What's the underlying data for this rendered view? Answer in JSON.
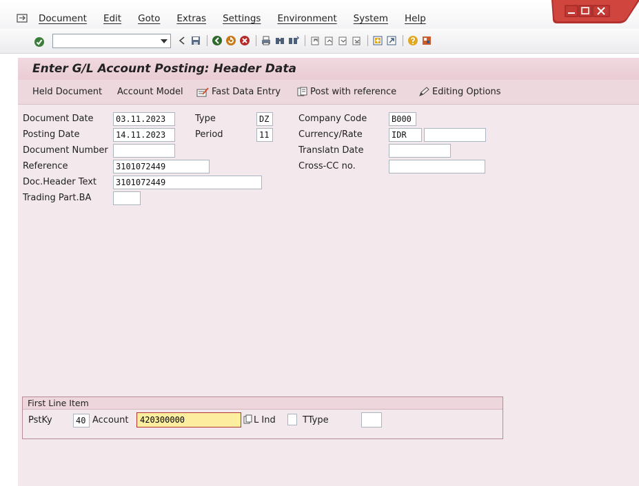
{
  "menubar": {
    "items": [
      "Document",
      "Edit",
      "Goto",
      "Extras",
      "Settings",
      "Environment",
      "System",
      "Help"
    ]
  },
  "toolbar": {
    "command_value": "",
    "icons": [
      "enter-icon",
      "back-icon",
      "save-icon",
      "back-green-icon",
      "exit-icon",
      "cancel-icon",
      "print-icon",
      "find-icon",
      "find-next-icon",
      "first-page-icon",
      "previous-page-icon",
      "next-page-icon",
      "last-page-icon",
      "create-session-icon",
      "shortcut-icon",
      "help-icon",
      "customize-layout-icon"
    ]
  },
  "page": {
    "title": "Enter G/L Account Posting: Header Data"
  },
  "app_toolbar": {
    "held_document": "Held Document",
    "account_model": "Account Model",
    "fast_data_entry": "Fast Data Entry",
    "post_with_reference": "Post with reference",
    "editing_options": "Editing Options"
  },
  "header": {
    "document_date_label": "Document Date",
    "document_date": "03.11.2023",
    "type_label": "Type",
    "type": "DZ",
    "company_code_label": "Company Code",
    "company_code": "B000",
    "posting_date_label": "Posting Date",
    "posting_date": "14.11.2023",
    "period_label": "Period",
    "period": "11",
    "currency_rate_label": "Currency/Rate",
    "currency": "IDR",
    "rate": "",
    "document_number_label": "Document Number",
    "document_number": "",
    "translation_date_label": "Translatn Date",
    "translation_date": "",
    "reference_label": "Reference",
    "reference": "3101072449",
    "cross_cc_label": "Cross-CC no.",
    "cross_cc": "",
    "doc_header_text_label": "Doc.Header Text",
    "doc_header_text": "3101072449",
    "trading_part_label": "Trading Part.BA",
    "trading_part": ""
  },
  "first_line_item": {
    "title": "First Line Item",
    "pstky_label": "PstKy",
    "pstky": "40",
    "account_label": "Account",
    "account": "420300000",
    "sgl_ind_label": "L Ind",
    "ttype_label": "TType",
    "ttype": ""
  },
  "colors": {
    "work_area": "#f3e9ec",
    "title_bar": "#e9ccd4",
    "focus_field": "#fbee9e",
    "focus_border": "#b3342c",
    "window_controls": "#b2302d"
  }
}
